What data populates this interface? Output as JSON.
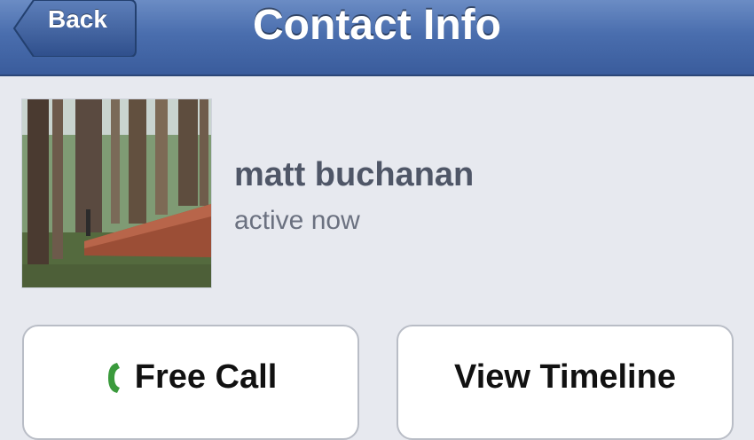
{
  "nav": {
    "back_label": "Back",
    "title": "Contact Info"
  },
  "contact": {
    "name": "matt buchanan",
    "status": "active now",
    "avatar_icon": "forest-photo"
  },
  "actions": {
    "call_label": "Free Call",
    "call_icon": "phone-icon",
    "call_icon_color": "#3a9a3c",
    "timeline_label": "View Timeline"
  },
  "colors": {
    "navbar": "#4a6eae",
    "background": "#e7e9ef"
  }
}
